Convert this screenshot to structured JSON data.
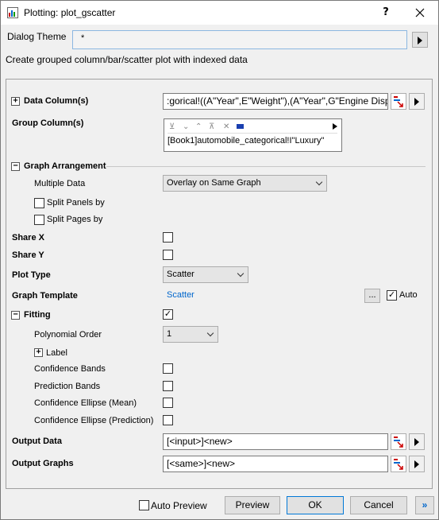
{
  "window": {
    "title": "Plotting: plot_gscatter",
    "help": "?",
    "close": "✕"
  },
  "theme": {
    "label": "Dialog Theme",
    "value": "*"
  },
  "description": "Create grouped column/bar/scatter plot with indexed data",
  "data_column": {
    "label": "Data Column(s)",
    "value": ":gorical!((A\"Year\",E\"Weight\"),(A\"Year\",G\"Engine Disp"
  },
  "group_column": {
    "label": "Group Column(s)",
    "value": "[Book1]automobile_categorical!I\"Luxury\""
  },
  "graph_arrangement": {
    "label": "Graph Arrangement",
    "multiple_data_label": "Multiple Data",
    "multiple_data_value": "Overlay on Same Graph",
    "split_panels": "Split Panels by",
    "split_pages": "Split Pages by"
  },
  "share_x": "Share X",
  "share_y": "Share Y",
  "plot_type": {
    "label": "Plot Type",
    "value": "Scatter"
  },
  "graph_template": {
    "label": "Graph Template",
    "value": "Scatter",
    "auto_label": "Auto",
    "browse": "..."
  },
  "fitting": {
    "label": "Fitting",
    "poly_label": "Polynomial Order",
    "poly_value": "1",
    "sublabel": "Label",
    "confidence_bands": "Confidence Bands",
    "prediction_bands": "Prediction Bands",
    "conf_ellipse_mean": "Confidence Ellipse (Mean)",
    "conf_ellipse_pred": "Confidence Ellipse (Prediction)"
  },
  "output_data": {
    "label": "Output Data",
    "value": "[<input>]<new>"
  },
  "output_graphs": {
    "label": "Output Graphs",
    "value": "[<same>]<new>"
  },
  "footer": {
    "auto_preview": "Auto Preview",
    "preview": "Preview",
    "ok": "OK",
    "cancel": "Cancel",
    "more": "»"
  }
}
